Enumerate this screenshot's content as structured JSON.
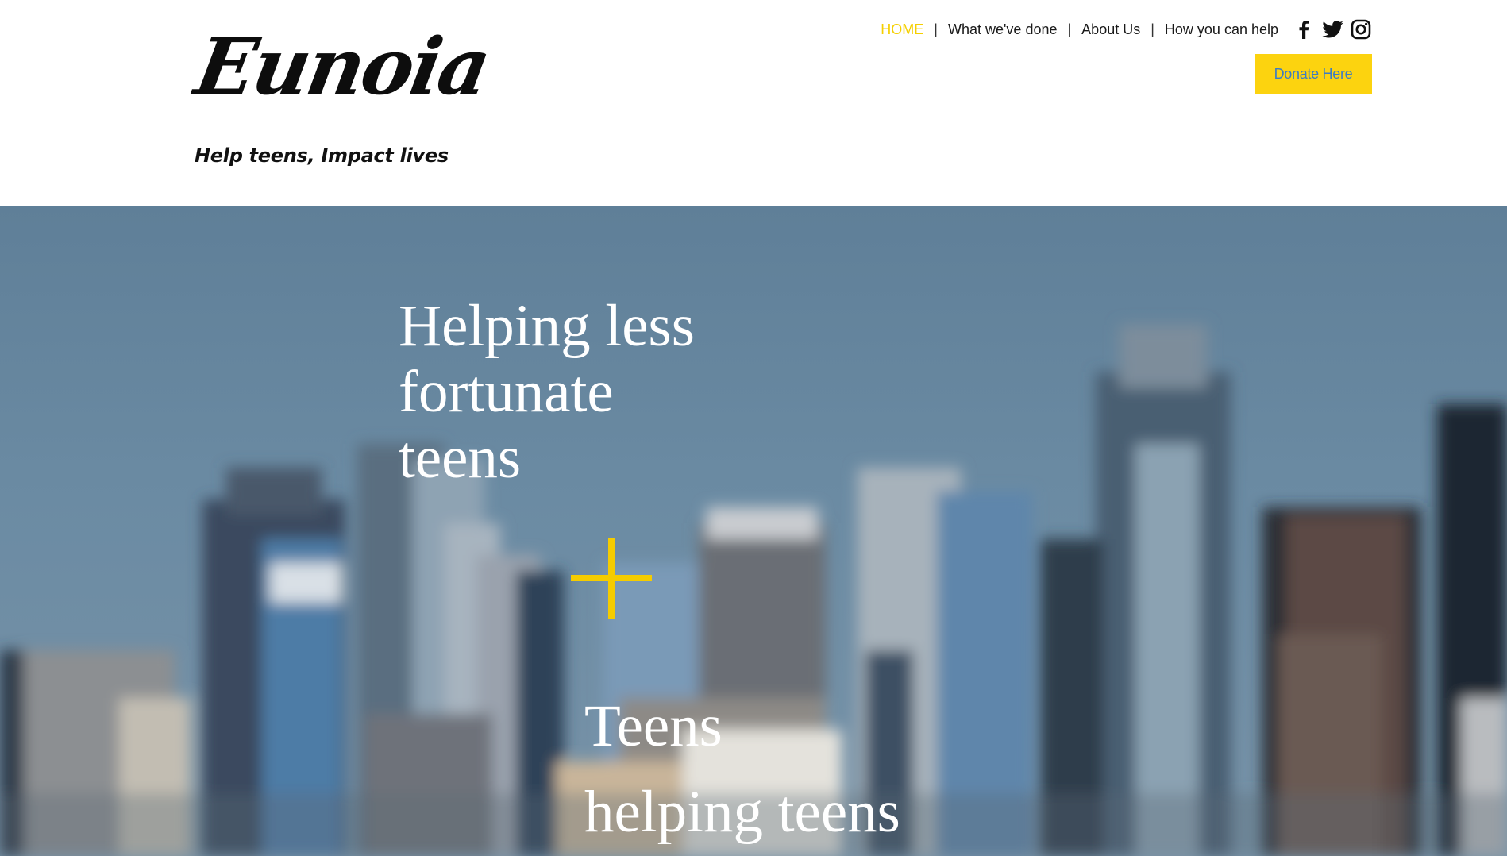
{
  "brand": {
    "logo_text": "Eunoia",
    "tagline": "Help teens, Impact lives"
  },
  "nav": {
    "items": [
      {
        "label": "HOME",
        "active": true
      },
      {
        "label": "What we've done",
        "active": false
      },
      {
        "label": "About Us",
        "active": false
      },
      {
        "label": "How you can help",
        "active": false
      }
    ],
    "separator": "|",
    "social": [
      "facebook-icon",
      "twitter-icon",
      "instagram-icon"
    ]
  },
  "donate": {
    "label": "Donate Here"
  },
  "hero": {
    "heading": "Helping less\nfortunate\nteens",
    "accent_symbol": "plus",
    "subheading": "Teens\nhelping teens"
  },
  "colors": {
    "accent": "#f5cc00",
    "nav_active": "#f5cf00",
    "donate_bg": "#fcd30f",
    "donate_text": "#3c7cc4",
    "hero_sky": "#6a8aa2"
  }
}
